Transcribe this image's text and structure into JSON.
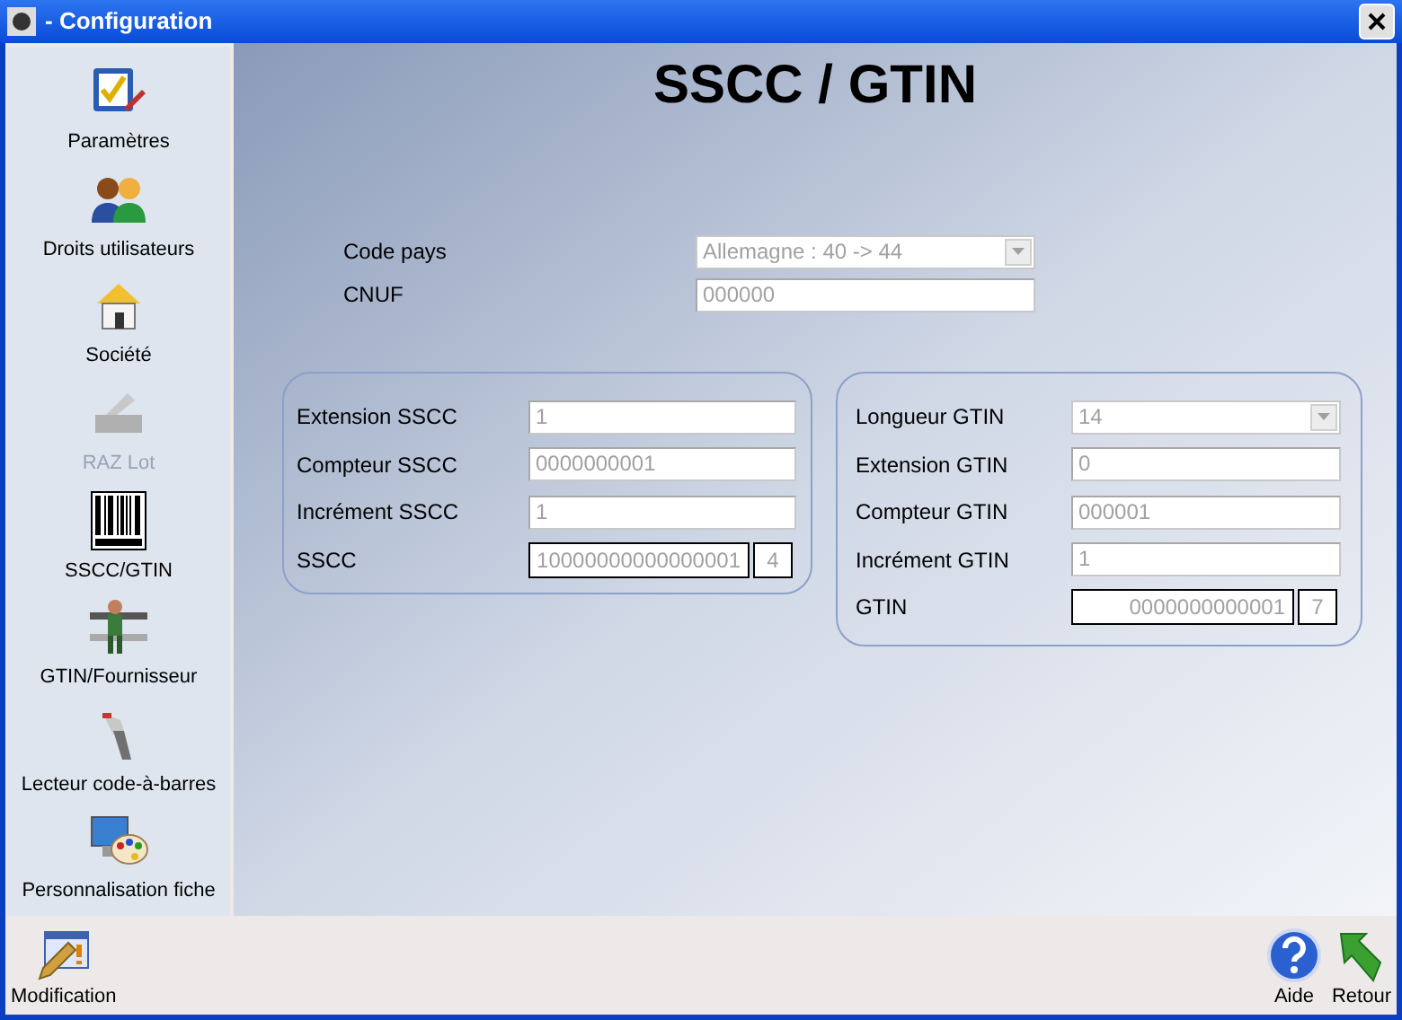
{
  "window": {
    "title": "- Configuration"
  },
  "sidebar": {
    "items": [
      {
        "label": "Paramètres",
        "disabled": false
      },
      {
        "label": "Droits utilisateurs",
        "disabled": false
      },
      {
        "label": "Société",
        "disabled": false
      },
      {
        "label": "RAZ Lot",
        "disabled": true
      },
      {
        "label": "SSCC/GTIN",
        "disabled": false
      },
      {
        "label": "GTIN/Fournisseur",
        "disabled": false
      },
      {
        "label": "Lecteur code-à-barres",
        "disabled": false
      },
      {
        "label": "Personnalisation fiche",
        "disabled": false
      }
    ]
  },
  "page_title": "SSCC / GTIN",
  "general": {
    "fields": [
      {
        "kind": "select",
        "label": "Code pays",
        "value": "Allemagne : 40 -> 44"
      },
      {
        "kind": "text",
        "label": "CNUF",
        "value": "000000"
      }
    ]
  },
  "sscc_group": {
    "fields": [
      {
        "kind": "text",
        "label": "Extension SSCC",
        "value": "1"
      },
      {
        "kind": "text",
        "label": "Compteur SSCC",
        "value": "0000000001"
      },
      {
        "kind": "text",
        "label": "Incrément SSCC",
        "value": "1"
      },
      {
        "kind": "code",
        "label": "SSCC",
        "value": "10000000000000001",
        "check_digit": "4"
      }
    ]
  },
  "gtin_group": {
    "fields": [
      {
        "kind": "select",
        "label": "Longueur GTIN",
        "value": "14"
      },
      {
        "kind": "text",
        "label": "Extension GTIN",
        "value": "0"
      },
      {
        "kind": "text",
        "label": "Compteur GTIN",
        "value": "000001"
      },
      {
        "kind": "text",
        "label": "Incrément GTIN",
        "value": "1"
      },
      {
        "kind": "code",
        "label": "GTIN",
        "value": "0000000000001",
        "check_digit": "7"
      }
    ]
  },
  "bottom_bar": {
    "left": [
      {
        "label": "Modification"
      }
    ],
    "right": [
      {
        "label": "Aide"
      },
      {
        "label": "Retour"
      }
    ]
  }
}
